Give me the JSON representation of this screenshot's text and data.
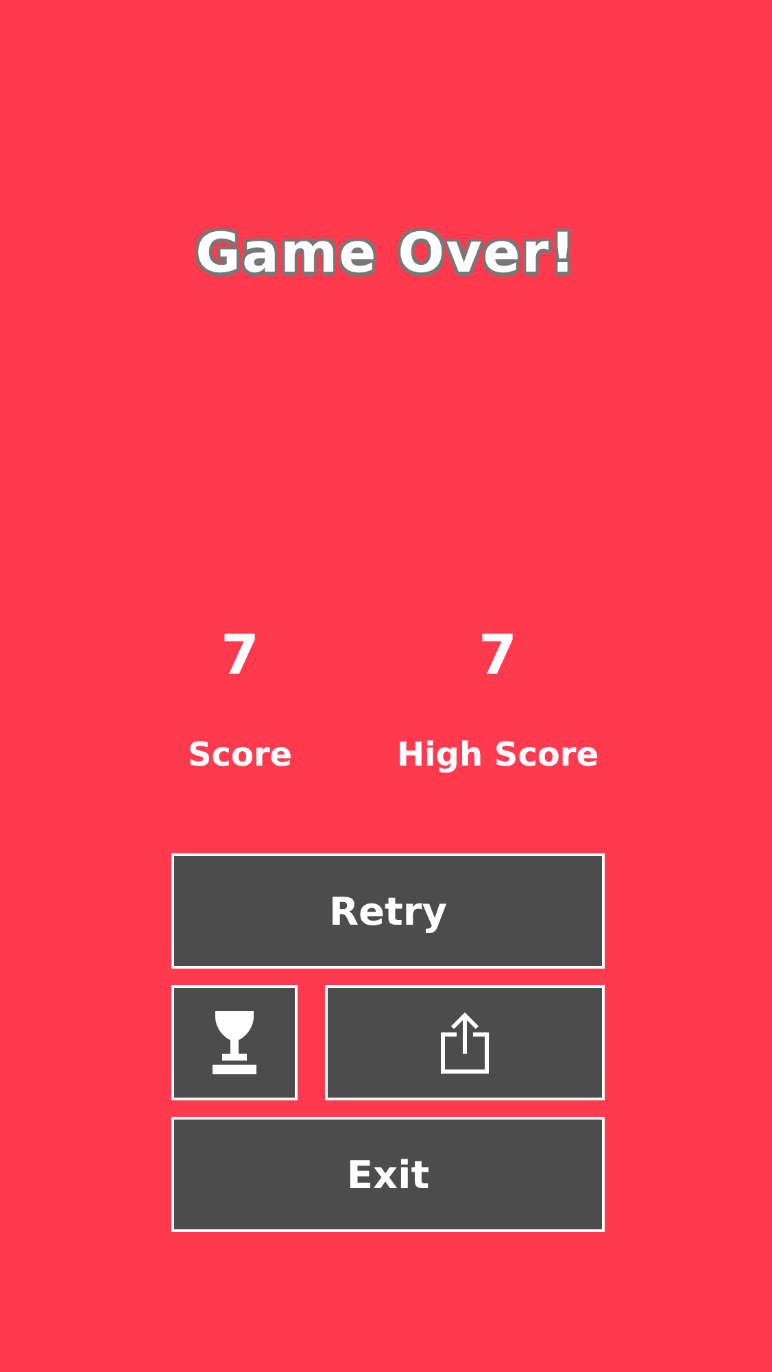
{
  "title": "Game Over!",
  "scores": [
    {
      "value": "7",
      "label": "Score"
    },
    {
      "value": "7",
      "label": "High Score"
    }
  ],
  "buttons": [
    {
      "kind": "text",
      "label": "Retry"
    },
    {
      "kind": "trophy"
    },
    {
      "kind": "share"
    },
    {
      "kind": "text",
      "label": "Exit"
    }
  ]
}
